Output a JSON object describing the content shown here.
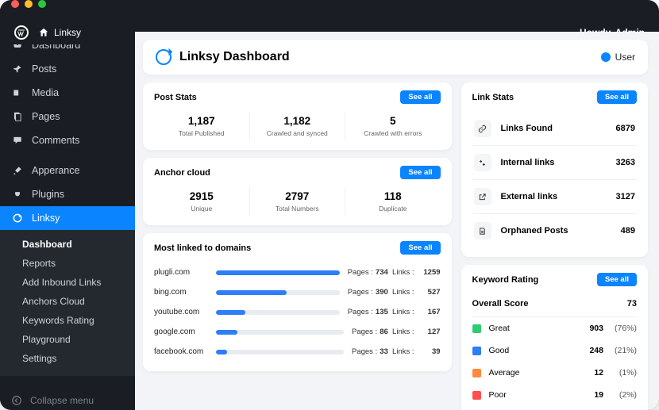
{
  "topbar": {
    "brand": "Linksy",
    "howdy": "Howdy, Admin"
  },
  "sidebar": {
    "items": [
      {
        "label": "Dashboard",
        "icon": "gauge"
      },
      {
        "label": "Posts",
        "icon": "pin"
      },
      {
        "label": "Media",
        "icon": "media"
      },
      {
        "label": "Pages",
        "icon": "page"
      },
      {
        "label": "Comments",
        "icon": "comment"
      },
      {
        "label": "Apperance",
        "icon": "brush"
      },
      {
        "label": "Plugins",
        "icon": "plug"
      },
      {
        "label": "Linksy",
        "icon": "linksy",
        "active": true
      }
    ],
    "sub": [
      "Dashboard",
      "Reports",
      "Add Inbound Links",
      "Anchors Cloud",
      "Keywords Rating",
      "Playground",
      "Settings"
    ],
    "sub_active": "Dashboard",
    "collapse": "Collapse menu"
  },
  "header": {
    "title": "Linksy Dashboard",
    "user": "User"
  },
  "btn": {
    "see_all": "See all"
  },
  "post_stats": {
    "title": "Post Stats",
    "items": [
      {
        "value": "1,187",
        "label": "Total Published"
      },
      {
        "value": "1,182",
        "label": "Crawled and synced"
      },
      {
        "value": "5",
        "label": "Crawled with errors"
      }
    ]
  },
  "anchor_cloud": {
    "title": "Anchor cloud",
    "items": [
      {
        "value": "2915",
        "label": "Unique"
      },
      {
        "value": "2797",
        "label": "Total Numbers"
      },
      {
        "value": "118",
        "label": "Duplicate"
      }
    ]
  },
  "link_stats": {
    "title": "Link Stats",
    "rows": [
      {
        "icon": "link",
        "label": "Links Found",
        "value": "6879"
      },
      {
        "icon": "internal",
        "label": "Internal links",
        "value": "3263"
      },
      {
        "icon": "external",
        "label": "External links",
        "value": "3127"
      },
      {
        "icon": "orphan",
        "label": "Orphaned Posts",
        "value": "489"
      }
    ]
  },
  "domains": {
    "title": "Most linked to domains",
    "rows": [
      {
        "name": "plugli.com",
        "pages": "734",
        "links": "1259",
        "pct": 100
      },
      {
        "name": "bing.com",
        "pages": "390",
        "links": "527",
        "pct": 57
      },
      {
        "name": "youtube.com",
        "pages": "135",
        "links": "167",
        "pct": 24
      },
      {
        "name": "google.com",
        "pages": "86",
        "links": "127",
        "pct": 17
      },
      {
        "name": "facebook.com",
        "pages": "33",
        "links": "39",
        "pct": 9
      }
    ],
    "pages_label": "Pages :",
    "links_label": "Links :"
  },
  "rating": {
    "title": "Keyword Rating",
    "overall_label": "Overall Score",
    "overall_value": "73",
    "rows": [
      {
        "color": "#2ecc71",
        "label": "Great",
        "value": "903",
        "pct": "(76%)"
      },
      {
        "color": "#2d7ef7",
        "label": "Good",
        "value": "248",
        "pct": "(21%)"
      },
      {
        "color": "#ff8a3d",
        "label": "Average",
        "value": "12",
        "pct": "(1%)"
      },
      {
        "color": "#ff4d4d",
        "label": "Poor",
        "value": "19",
        "pct": "(2%)"
      }
    ]
  }
}
